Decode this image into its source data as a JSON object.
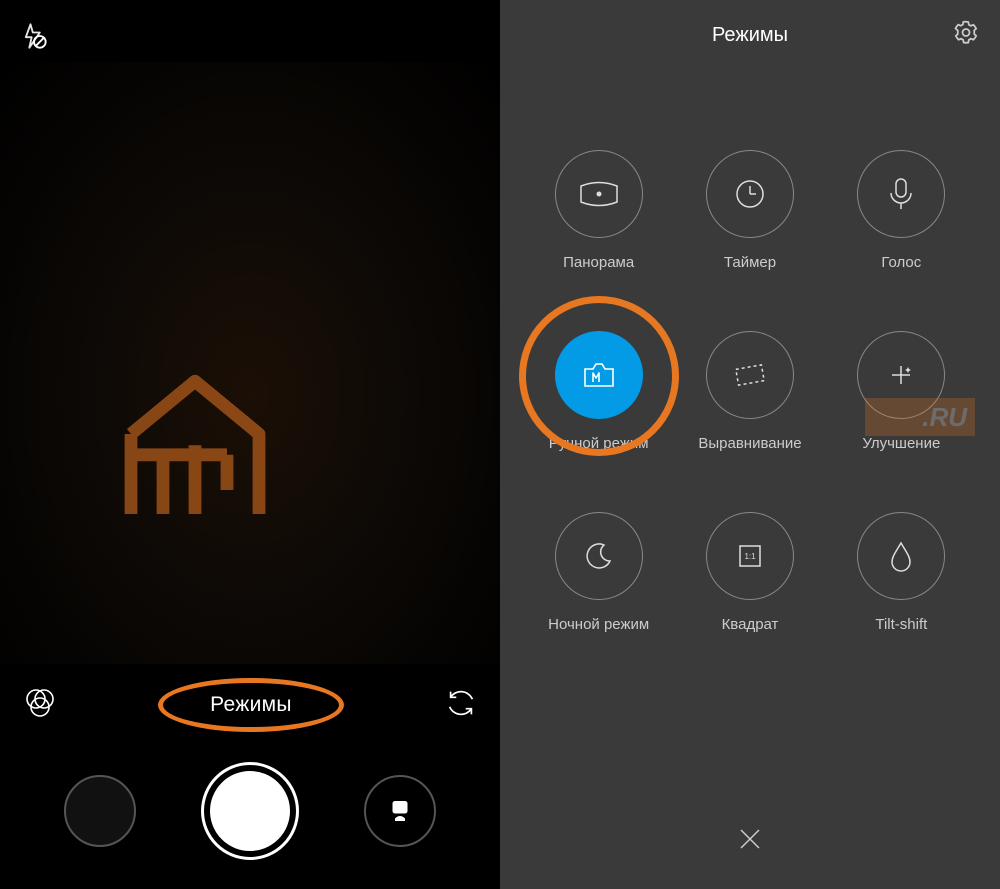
{
  "left": {
    "modes_label": "Режимы"
  },
  "right": {
    "title": "Режимы",
    "modes": [
      {
        "label": "Панорама"
      },
      {
        "label": "Таймер"
      },
      {
        "label": "Голос"
      },
      {
        "label": "Ручной режим"
      },
      {
        "label": "Выравнивание"
      },
      {
        "label": "Улучшение"
      },
      {
        "label": "Ночной режим"
      },
      {
        "label": "Квадрат"
      },
      {
        "label": "Tilt-shift"
      }
    ]
  },
  "watermark": {
    "ru": ".RU"
  }
}
